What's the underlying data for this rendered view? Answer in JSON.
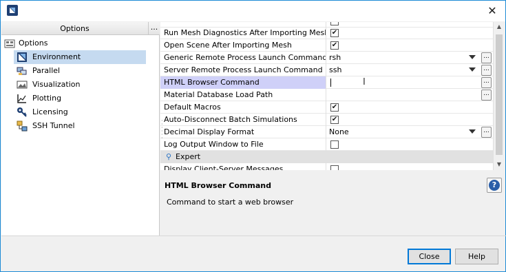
{
  "window": {
    "close_glyph": "✕"
  },
  "left": {
    "header": "Options",
    "header_btn": "...",
    "tree": [
      {
        "label": "Options",
        "icon": "options-icon"
      },
      {
        "label": "Environment",
        "icon": "environment-icon"
      },
      {
        "label": "Parallel",
        "icon": "parallel-icon"
      },
      {
        "label": "Visualization",
        "icon": "visualization-icon"
      },
      {
        "label": "Plotting",
        "icon": "plotting-icon"
      },
      {
        "label": "Licensing",
        "icon": "key-icon"
      },
      {
        "label": "SSH Tunnel",
        "icon": "ssh-tunnel-icon"
      }
    ]
  },
  "grid": {
    "rows": [
      {
        "name": "Run Mesh Diagnostics After Importing Mesh",
        "type": "checkbox",
        "checked": true
      },
      {
        "name": "Open Scene After Importing Mesh",
        "type": "checkbox",
        "checked": true
      },
      {
        "name": "Generic Remote Process Launch Command",
        "type": "dropdown",
        "value": "rsh"
      },
      {
        "name": "Server Remote Process Launch Command",
        "type": "dropdown",
        "value": "ssh"
      },
      {
        "name": "HTML Browser Command",
        "type": "text",
        "value": ""
      },
      {
        "name": "Material Database Load Path",
        "type": "text",
        "value": ""
      },
      {
        "name": "Default Macros",
        "type": "checkbox",
        "checked": true
      },
      {
        "name": "Auto-Disconnect Batch Simulations",
        "type": "checkbox",
        "checked": true
      },
      {
        "name": "Decimal Display Format",
        "type": "dropdown",
        "value": "None"
      },
      {
        "name": "Log Output Window to File",
        "type": "checkbox",
        "checked": false
      }
    ],
    "group_label": "Expert",
    "after_group": {
      "name": "Display Client-Server Messages",
      "type": "checkbox",
      "checked": false
    },
    "check_glyph": "✔",
    "dots_label": "..."
  },
  "description": {
    "title": "HTML Browser Command",
    "text": "Command to start a web browser",
    "help_glyph": "?"
  },
  "buttons": {
    "close": "Close",
    "help": "Help"
  }
}
